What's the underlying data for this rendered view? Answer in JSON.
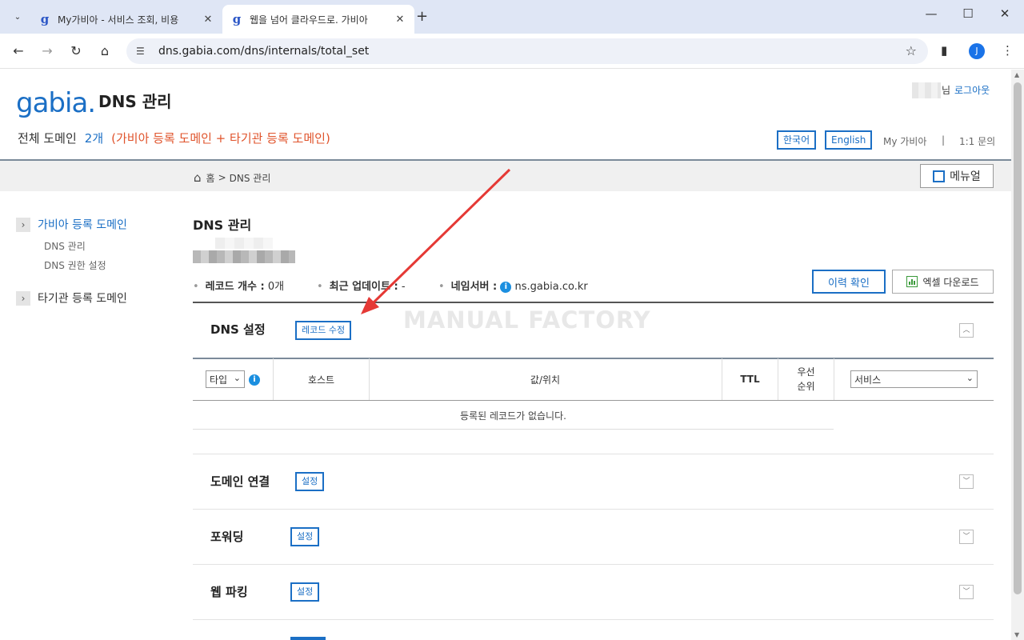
{
  "browser": {
    "tabs": [
      {
        "title": "My가비아 - 서비스 조회, 비용",
        "active": false
      },
      {
        "title": "웹을 넘어 클라우드로. 가비아",
        "active": true
      }
    ],
    "new_tab": "+",
    "url": "dns.gabia.com/dns/internals/total_set",
    "avatar_letter": "J"
  },
  "header": {
    "logo_text": "gabia.",
    "page_title": "DNS 관리",
    "user_suffix": "님",
    "logout": "로그아웃",
    "domain_summary": {
      "label": "전체 도메인",
      "count": "2개",
      "detail": "(가비아 등록 도메인 + 타기관 등록 도메인)"
    },
    "lang_ko": "한국어",
    "lang_en": "English",
    "my_gabia": "My 가비아",
    "separator": "|",
    "inquiry": "1:1 문의"
  },
  "breadcrumb": {
    "home": "홈",
    "sep": ">",
    "current": "DNS 관리"
  },
  "manual_button": "메뉴얼",
  "sidebar": {
    "items": [
      {
        "label": "가비아 등록 도메인",
        "active": true,
        "sub": [
          "DNS 관리",
          "DNS 권한 설정"
        ]
      },
      {
        "label": "타기관 등록 도메인",
        "active": false,
        "sub": []
      }
    ]
  },
  "main": {
    "title": "DNS 관리",
    "info": {
      "record_count_label": "레코드 개수 :",
      "record_count_value": "0개",
      "last_update_label": "최근 업데이트 :",
      "last_update_value": "-",
      "nameserver_label": "네임서버 :",
      "nameserver_value": "ns.gabia.co.kr"
    },
    "history_button": "이력 확인",
    "excel_button": "엑셀 다운로드",
    "watermark": "MANUAL FACTORY",
    "sections": {
      "dns": {
        "title": "DNS 설정",
        "button": "레코드 수정"
      },
      "connect": {
        "title": "도메인 연결",
        "button": "설정"
      },
      "forward": {
        "title": "포워딩",
        "button": "설정"
      },
      "parking": {
        "title": "웹 파킹",
        "button": "설정"
      }
    },
    "table": {
      "type_select": "타입",
      "headers": {
        "host": "호스트",
        "value": "값/위치",
        "ttl": "TTL",
        "priority_1": "우선",
        "priority_2": "순위"
      },
      "service_select": "서비스",
      "empty_message": "등록된 레코드가 없습니다."
    }
  },
  "colors": {
    "brand": "#1b6fc5",
    "accent": "#e0542c",
    "arrow": "#e53935"
  }
}
